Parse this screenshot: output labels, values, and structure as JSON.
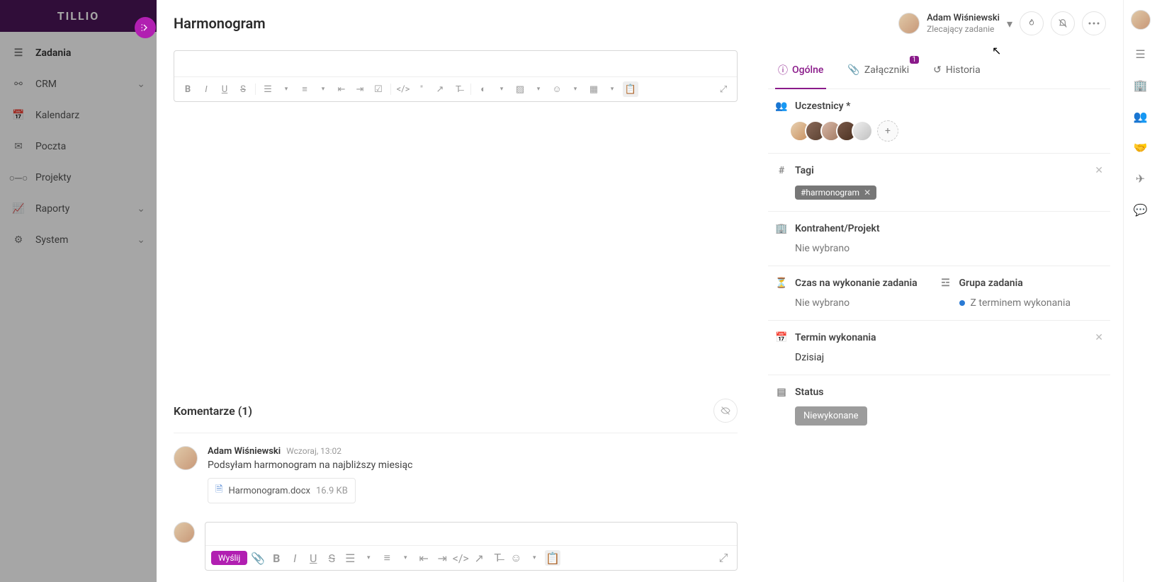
{
  "app": {
    "name": "TILLIO"
  },
  "sidebar": {
    "items": [
      {
        "icon": "tasks",
        "label": "Zadania",
        "active": true
      },
      {
        "icon": "crm",
        "label": "CRM",
        "chev": true
      },
      {
        "icon": "calendar",
        "label": "Kalendarz"
      },
      {
        "icon": "mail",
        "label": "Poczta"
      },
      {
        "icon": "projects",
        "label": "Projekty"
      },
      {
        "icon": "reports",
        "label": "Raporty",
        "chev": true
      },
      {
        "icon": "system",
        "label": "System",
        "chev": true
      }
    ]
  },
  "header": {
    "title": "Harmonogram",
    "user": {
      "name": "Adam Wiśniewski",
      "role": "Zlecający zadanie"
    }
  },
  "tabs": [
    {
      "icon": "info",
      "label": "Ogólne",
      "active": true
    },
    {
      "icon": "clip",
      "label": "Załączniki",
      "badge": "1"
    },
    {
      "icon": "history",
      "label": "Historia"
    }
  ],
  "panel": {
    "participants": {
      "label": "Uczestnicy *"
    },
    "tags": {
      "label": "Tagi",
      "chip": "#harmonogram"
    },
    "contractor": {
      "label": "Kontrahent/Projekt",
      "value": "Nie wybrano"
    },
    "time": {
      "label": "Czas na wykonanie zadania",
      "value": "Nie wybrano"
    },
    "group": {
      "label": "Grupa zadania",
      "value": "Z terminem wykonania"
    },
    "due": {
      "label": "Termin wykonania",
      "value": "Dzisiaj"
    },
    "status": {
      "label": "Status",
      "value": "Niewykonane"
    }
  },
  "comments": {
    "title": "Komentarze (1)",
    "items": [
      {
        "author": "Adam Wiśniewski",
        "time": "Wczoraj, 13:02",
        "text": "Podsyłam harmonogram na najbliższy miesiąc",
        "attachment": {
          "name": "Harmonogram.docx",
          "size": "16.9 KB"
        }
      }
    ],
    "send": "Wyślij"
  }
}
